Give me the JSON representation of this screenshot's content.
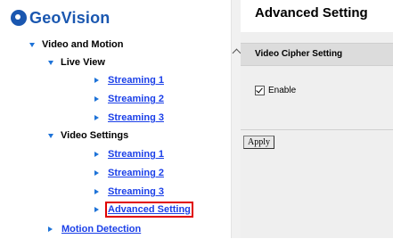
{
  "brand": {
    "name": "GeoVision"
  },
  "tree": {
    "video_and_motion": "Video and Motion",
    "live_view": "Live View",
    "live_streaming_1": "Streaming 1",
    "live_streaming_2": "Streaming 2",
    "live_streaming_3": "Streaming 3",
    "video_settings": "Video Settings",
    "vs_streaming_1": "Streaming 1",
    "vs_streaming_2": "Streaming 2",
    "vs_streaming_3": "Streaming 3",
    "advanced_setting": "Advanced Setting",
    "motion_detection": "Motion Detection"
  },
  "main": {
    "title": "Advanced Setting",
    "section_title": "Video Cipher Setting",
    "enable_label": "Enable",
    "enable_checked": true,
    "apply_label": "Apply"
  },
  "colors": {
    "link": "#1a3fe8",
    "brand": "#1a57b0",
    "highlight": "#e00000",
    "tree_arrow": "#1e73d8"
  }
}
